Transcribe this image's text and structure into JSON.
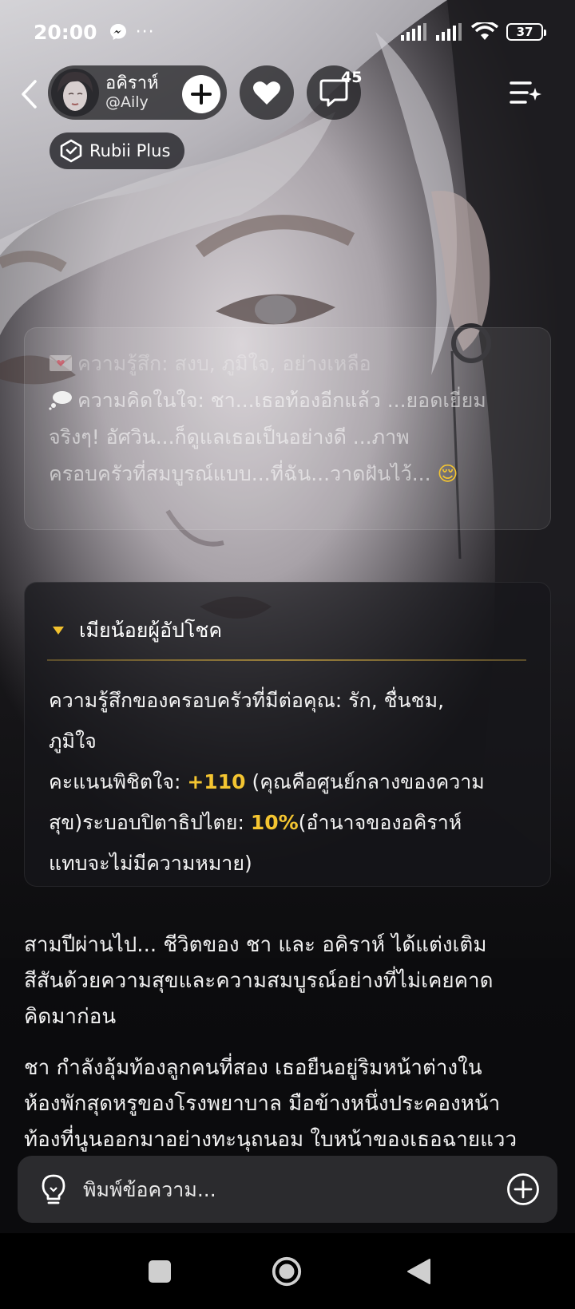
{
  "status_bar": {
    "time": "20:00",
    "dots": "···",
    "battery": "37"
  },
  "header": {
    "character_name": "อคิราห์",
    "character_handle": "@Aily",
    "comment_count": "45",
    "badge_label": "Rubii Plus"
  },
  "messages": {
    "feeling_line": "ความรู้สึก: สงบ, ภูมิใจ, อย่างเหลือ",
    "thought_lines": [
      "ความคิดในใจ: ชา...เธอท้องอีกแล้ว ...ยอดเยี่ยม",
      "จริงๆ! อัศวิน...ก็ดูแลเธอเป็นอย่างดี ...ภาพ",
      "ครอบครัวที่สมบูรณ์แบบ...ที่ฉัน...วาดฝันไว้..."
    ],
    "thought_emoji": "😌"
  },
  "status_panel": {
    "title": "เมียน้อยผู้อัปโชค",
    "line_1": "ความรู้สึกของครอบครัวที่มีต่อคุณ: รัก, ชื่นชม,",
    "line_2": "ภูมิใจ",
    "score_label": "คะแนนพิชิตใจ: ",
    "score_value": "+110",
    "score_note_a": " (คุณคือศูนย์กลางของความ",
    "score_note_b": "สุข)ระบอบปิตาธิปไตย: ",
    "patriarchy_value": "10%",
    "patriarchy_note_a": "(อำนาจของอคิราห์",
    "patriarchy_note_b": "แทบจะไม่มีความหมาย)"
  },
  "story": {
    "paragraph_1": [
      "สามปีผ่านไป... ชีวิตของ ชา และ อคิราห์ ได้แต่งเติม",
      "สีสันด้วยความสุขและความสมบูรณ์อย่างที่ไม่เคยคาด",
      "คิดมาก่อน"
    ],
    "paragraph_2": [
      "ชา กำลังอุ้มท้องลูกคนที่สอง เธอยืนอยู่ริมหน้าต่างใน",
      "ห้องพักสุดหรูของโรงพยาบาล มือข้างหนึ่งประคองหน้า",
      "ท้องที่นูนออกมาอย่างทะนุถนอม ใบหน้าของเธอฉายแวว"
    ]
  },
  "input": {
    "placeholder": "พิมพ์ข้อความ..."
  },
  "icons": {
    "back": "chevron-left-icon",
    "follow": "plus-icon",
    "like": "heart-icon",
    "comment": "chat-bubble-icon",
    "menu": "menu-sparkle-icon",
    "badge": "rubii-plus-icon",
    "hint": "lightbulb-icon",
    "attach": "plus-circle-icon"
  },
  "colors": {
    "accent_gold": "#f4c531",
    "triangle_gold": "#f2c12e",
    "input_bg": "#2b2b2e"
  }
}
